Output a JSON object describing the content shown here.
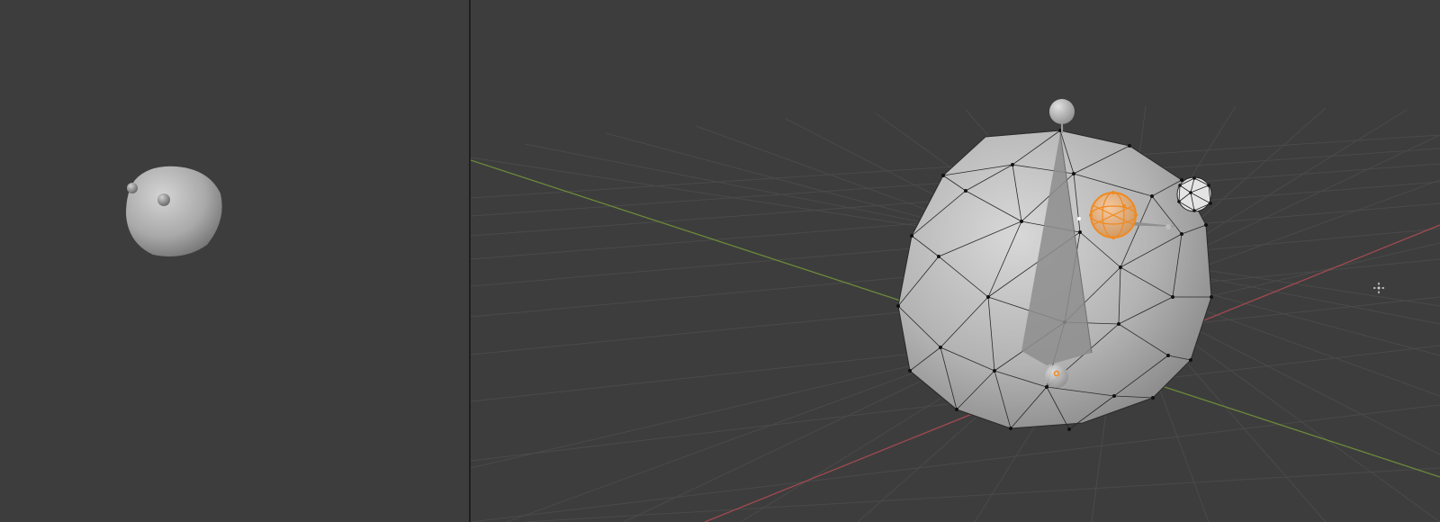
{
  "app": "Blender",
  "colors": {
    "viewport_bg": "#3d3d3d",
    "grid_line": "#4a4a4a",
    "x_axis": "#a04a50",
    "y_axis": "#6b8a3a",
    "mesh_gray": "#b5b5b5",
    "selection_orange": "#f08a20",
    "divider": "#1f1f1f"
  },
  "left_viewport": {
    "mode": "render-preview",
    "objects": [
      "main-sphere",
      "small-sphere-1",
      "small-sphere-2"
    ]
  },
  "right_viewport": {
    "mode": "edit-wireframe",
    "objects": [
      "icosphere-main",
      "top-sphere",
      "cone-spike",
      "selected-sphere",
      "ico-sphere-small",
      "bottom-sphere"
    ],
    "cursor_icon": "3d-cursor-icon"
  }
}
